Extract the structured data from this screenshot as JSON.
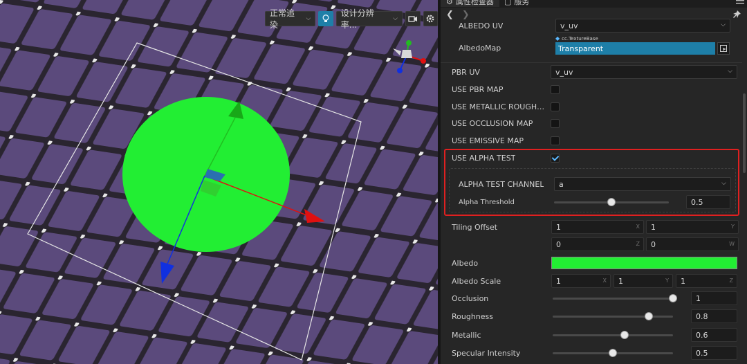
{
  "scene": {
    "render_mode": "正常追染",
    "resolution": "设计分辨率...",
    "tool_icons": [
      "render-mode-chevron-icon",
      "lightbulb-icon",
      "resolution-chevron-icon",
      "camera-icon",
      "gear-icon"
    ]
  },
  "inspector": {
    "tabs": [
      {
        "label": "属性检查器"
      },
      {
        "label": "服务"
      }
    ],
    "albedo_uv": {
      "label": "ALBEDO UV",
      "value": "v_uv"
    },
    "albedo_map": {
      "label": "AlbedoMap",
      "type_tag": "cc.TextureBase",
      "value": "Transparent"
    },
    "pbr_uv": {
      "label": "PBR UV",
      "value": "v_uv"
    },
    "toggles": [
      {
        "label": "USE PBR MAP",
        "checked": false
      },
      {
        "label": "USE METALLIC ROUGHNE...",
        "checked": false
      },
      {
        "label": "USE OCCLUSION MAP",
        "checked": false
      },
      {
        "label": "USE EMISSIVE MAP",
        "checked": false
      },
      {
        "label": "USE ALPHA TEST",
        "checked": true
      }
    ],
    "alpha_test_channel": {
      "label": "ALPHA TEST CHANNEL",
      "value": "a"
    },
    "alpha_threshold": {
      "label": "Alpha Threshold",
      "value": "0.5",
      "fraction": 0.5
    },
    "tiling_offset": {
      "label": "Tiling Offset",
      "x": "1",
      "y": "1",
      "z": "0",
      "w": "0",
      "axes": {
        "x": "X",
        "y": "Y",
        "z": "Z",
        "w": "W"
      }
    },
    "albedo": {
      "label": "Albedo",
      "color": "#22ee33"
    },
    "albedo_scale": {
      "label": "Albedo Scale",
      "x": "1",
      "y": "1",
      "z": "1"
    },
    "occlusion": {
      "label": "Occlusion",
      "value": "1",
      "fraction": 1.0
    },
    "roughness": {
      "label": "Roughness",
      "value": "0.8",
      "fraction": 0.8
    },
    "metallic": {
      "label": "Metallic",
      "value": "0.6",
      "fraction": 0.6
    },
    "specular_intensity": {
      "label": "Specular Intensity",
      "value": "0.5",
      "fraction": 0.5
    }
  },
  "colors": {
    "highlight": "#e02020",
    "accent": "#1e7fa8",
    "scene_bg": "#5a4a78",
    "gizmo_x": "#e01010",
    "gizmo_y": "#20c020",
    "gizmo_z": "#1030e0"
  }
}
